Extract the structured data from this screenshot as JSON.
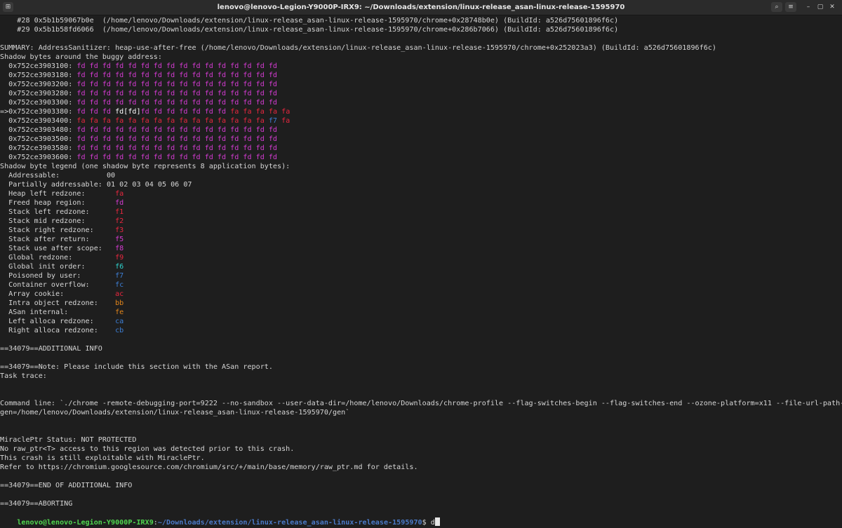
{
  "window": {
    "title": "lenovo@lenovo-Legion-Y9000P-IRX9: ~/Downloads/extension/linux-release_asan-linux-release-1595970",
    "new_tab_icon": "terminal-tab-icon",
    "search_icon": "search-icon",
    "menu_icon": "hamburger-menu-icon",
    "minimize_glyph": "–",
    "maximize_glyph": "▢",
    "close_glyph": "✕",
    "search_glyph": "⌕",
    "menu_glyph": "≡",
    "tab_glyph": "⊞"
  },
  "terminal": {
    "frame28": "    #28 0x5b1b59067b0e  (/home/lenovo/Downloads/extension/linux-release_asan-linux-release-1595970/chrome+0x28748b0e) (BuildId: a526d75601896f6c)",
    "frame29": "    #29 0x5b1b58fd6066  (/home/lenovo/Downloads/extension/linux-release_asan-linux-release-1595970/chrome+0x286b7066) (BuildId: a526d75601896f6c)",
    "summary": "SUMMARY: AddressSanitizer: heap-use-after-free (/home/lenovo/Downloads/extension/linux-release_asan-linux-release-1595970/chrome+0x252023a3) (BuildId: a526d75601896f6c)",
    "shadow_header": "Shadow bytes around the buggy address:",
    "shadow_rows": [
      {
        "prefix": "  0x752ce3903100: ",
        "cells": [
          [
            "fd",
            "fd fd fd fd fd fd fd fd fd fd fd fd fd fd fd fd"
          ]
        ]
      },
      {
        "prefix": "  0x752ce3903180: ",
        "cells": [
          [
            "fd",
            "fd fd fd fd fd fd fd fd fd fd fd fd fd fd fd fd"
          ]
        ]
      },
      {
        "prefix": "  0x752ce3903200: ",
        "cells": [
          [
            "fd",
            "fd fd fd fd fd fd fd fd fd fd fd fd fd fd fd fd"
          ]
        ]
      },
      {
        "prefix": "  0x752ce3903280: ",
        "cells": [
          [
            "fd",
            "fd fd fd fd fd fd fd fd fd fd fd fd fd fd fd fd"
          ]
        ]
      },
      {
        "prefix": "  0x752ce3903300: ",
        "cells": [
          [
            "fd",
            "fd fd fd fd fd fd fd fd fd fd fd fd fd fd fd fd"
          ]
        ]
      },
      {
        "prefix": "=>0x752ce3903380: ",
        "cells": [
          [
            "fd",
            "fd fd fd "
          ],
          [
            "cur",
            "fd[fd]"
          ],
          [
            "fd",
            "fd fd fd fd fd fd fd "
          ],
          [
            "fa",
            "fa fa fa fa fa"
          ]
        ]
      },
      {
        "prefix": "  0x752ce3903400: ",
        "cells": [
          [
            "fa",
            "fa fa fa fa fa fa fa fa fa fa fa fa fa fa fa "
          ],
          [
            "f7",
            "f7"
          ],
          [
            "fa",
            " fa"
          ]
        ]
      },
      {
        "prefix": "  0x752ce3903480: ",
        "cells": [
          [
            "fd",
            "fd fd fd fd fd fd fd fd fd fd fd fd fd fd fd fd"
          ]
        ]
      },
      {
        "prefix": "  0x752ce3903500: ",
        "cells": [
          [
            "fd",
            "fd fd fd fd fd fd fd fd fd fd fd fd fd fd fd fd"
          ]
        ]
      },
      {
        "prefix": "  0x752ce3903580: ",
        "cells": [
          [
            "fd",
            "fd fd fd fd fd fd fd fd fd fd fd fd fd fd fd fd"
          ]
        ]
      },
      {
        "prefix": "  0x752ce3903600: ",
        "cells": [
          [
            "fd",
            "fd fd fd fd fd fd fd fd fd fd fd fd fd fd fd fd"
          ]
        ]
      }
    ],
    "legend_header": "Shadow byte legend (one shadow byte represents 8 application bytes):",
    "legend": [
      {
        "label": "  Addressable:           ",
        "value": "00",
        "color": "white"
      },
      {
        "label": "  Partially addressable: ",
        "value": "01 02 03 04 05 06 07",
        "color": "white"
      },
      {
        "label": "  Heap left redzone:       ",
        "value": "fa",
        "color": "red"
      },
      {
        "label": "  Freed heap region:       ",
        "value": "fd",
        "color": "mag"
      },
      {
        "label": "  Stack left redzone:      ",
        "value": "f1",
        "color": "red"
      },
      {
        "label": "  Stack mid redzone:       ",
        "value": "f2",
        "color": "red"
      },
      {
        "label": "  Stack right redzone:     ",
        "value": "f3",
        "color": "red"
      },
      {
        "label": "  Stack after return:      ",
        "value": "f5",
        "color": "mag"
      },
      {
        "label": "  Stack use after scope:   ",
        "value": "f8",
        "color": "mag"
      },
      {
        "label": "  Global redzone:          ",
        "value": "f9",
        "color": "red"
      },
      {
        "label": "  Global init order:       ",
        "value": "f6",
        "color": "cyan"
      },
      {
        "label": "  Poisoned by user:        ",
        "value": "f7",
        "color": "blue"
      },
      {
        "label": "  Container overflow:      ",
        "value": "fc",
        "color": "blue"
      },
      {
        "label": "  Array cookie:            ",
        "value": "ac",
        "color": "red"
      },
      {
        "label": "  Intra object redzone:    ",
        "value": "bb",
        "color": "orange"
      },
      {
        "label": "  ASan internal:           ",
        "value": "fe",
        "color": "orange"
      },
      {
        "label": "  Left alloca redzone:     ",
        "value": "ca",
        "color": "blue"
      },
      {
        "label": "  Right alloca redzone:    ",
        "value": "cb",
        "color": "blue"
      }
    ],
    "additional_info": "==34079==ADDITIONAL INFO",
    "note": "==34079==Note: Please include this section with the ASan report.",
    "task_trace": "Task trace:",
    "cmdline_1": "Command line: `./chrome -remote-debugging-port=9222 --no-sandbox --user-data-dir=/home/lenovo/Downloads/chrome-profile --flag-switches-begin --flag-switches-end --ozone-platform=x11 --file-url-path-alias=/",
    "cmdline_2": "gen=/home/lenovo/Downloads/extension/linux-release_asan-linux-release-1595970/gen`",
    "miracle_status": "MiraclePtr Status: NOT PROTECTED",
    "miracle_1": "No raw_ptr<T> access to this region was detected prior to this crash.",
    "miracle_2": "This crash is still exploitable with MiraclePtr.",
    "miracle_3": "Refer to https://chromium.googlesource.com/chromium/src/+/main/base/memory/raw_ptr.md for details.",
    "end_info": "==34079==END OF ADDITIONAL INFO",
    "aborting": "==34079==ABORTING",
    "prompt_user": "lenovo@lenovo-Legion-Y9000P-IRX9",
    "prompt_colon": ":",
    "prompt_path": "~/Downloads/extension/linux-release_asan-linux-release-1595970",
    "prompt_dollar": "$ ",
    "prompt_input": "d"
  },
  "colors": {
    "fd": "#d43bd2",
    "fa": "#e8273f",
    "f7": "#3d7fd6",
    "prompt_user": "#4fd64f",
    "prompt_path": "#4b7ac8",
    "background": "#1e1e1e"
  }
}
